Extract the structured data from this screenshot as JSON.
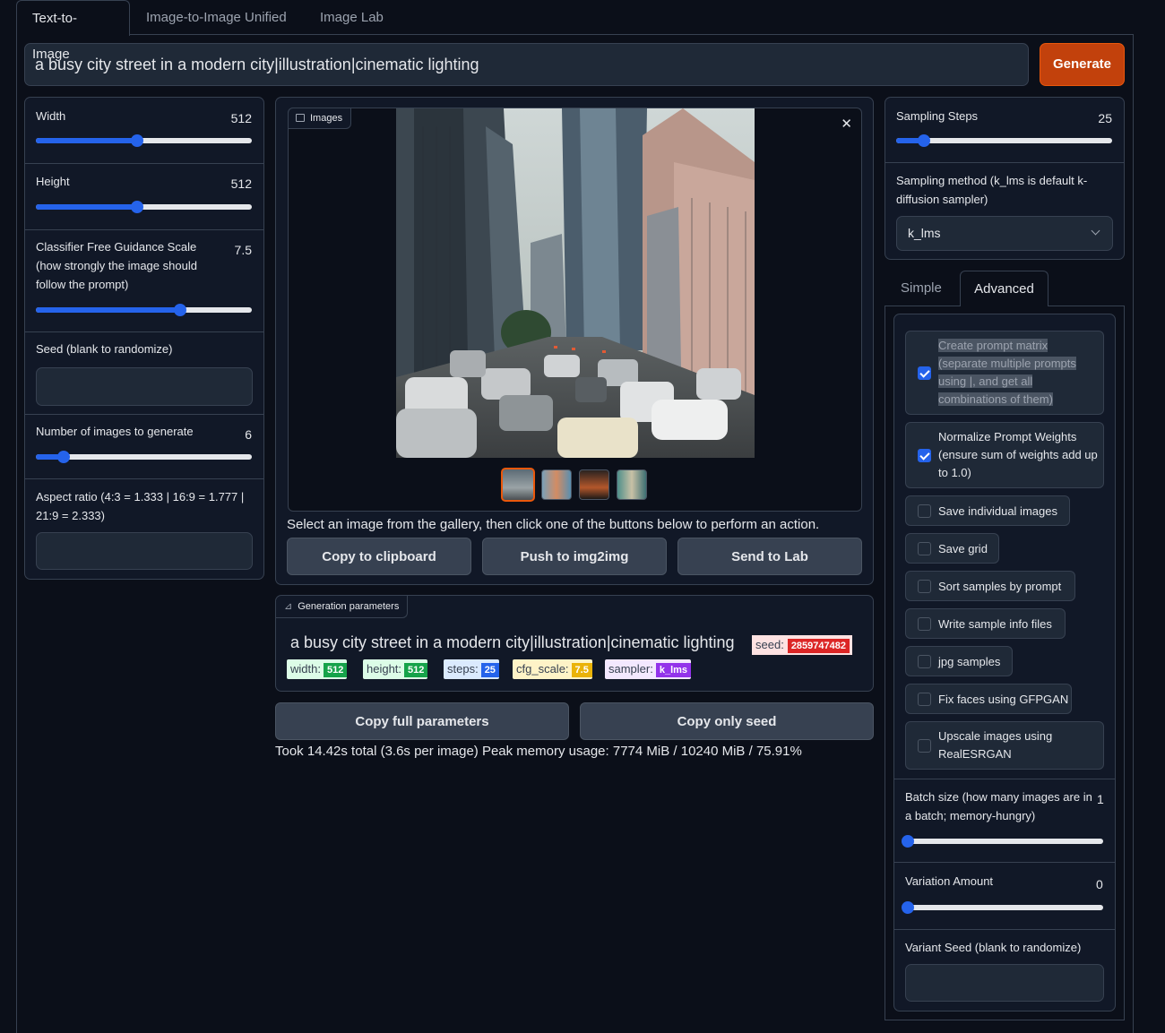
{
  "tabs": [
    "Text-to-Image",
    "Image-to-Image Unified",
    "Image Lab"
  ],
  "prompt": "a busy city street in a modern city|illustration|cinematic lighting",
  "generate_label": "Generate",
  "left": {
    "width": {
      "label": "Width",
      "value": "512",
      "level": 0.47
    },
    "height": {
      "label": "Height",
      "value": "512",
      "level": 0.47
    },
    "cfg": {
      "label": "Classifier Free Guidance Scale (how strongly the image should follow the prompt)",
      "value": "7.5",
      "level": 0.67
    },
    "seed": {
      "label": "Seed (blank to randomize)",
      "value": ""
    },
    "num_images": {
      "label": "Number of images to generate",
      "value": "6",
      "level": 0.13
    },
    "aspect": {
      "label": "Aspect ratio (4:3 = 1.333 | 16:9 = 1.777 | 21:9 = 2.333)",
      "value": ""
    }
  },
  "gallery": {
    "label": "Images",
    "hint": "Select an image from the gallery, then click one of the buttons below to perform an action.",
    "buttons": [
      "Copy to clipboard",
      "Push to img2img",
      "Send to Lab"
    ],
    "thumbnail_count": 4,
    "selected_thumbnail": 1
  },
  "params": {
    "label": "Generation parameters",
    "prompt": "a busy city street in a modern city|illustration|cinematic lighting",
    "seed_key": "seed:",
    "seed_value": "2859747482",
    "chips": [
      {
        "key": "width:",
        "value": "512"
      },
      {
        "key": "height:",
        "value": "512"
      },
      {
        "key": "steps:",
        "value": "25"
      },
      {
        "key": "cfg_scale:",
        "value": "7.5"
      },
      {
        "key": "sampler:",
        "value": "k_lms"
      }
    ]
  },
  "copy_full_label": "Copy full parameters",
  "copy_seed_label": "Copy only seed",
  "stats": "Took 14.42s total (3.6s per image) Peak memory usage: 7774 MiB / 10240 MiB / 75.91%",
  "right": {
    "steps": {
      "label": "Sampling Steps",
      "value": "25",
      "level": 0.13
    },
    "sampler": {
      "label": "Sampling method (k_lms is default k-diffusion sampler)",
      "value": "k_lms"
    },
    "subtabs": [
      "Simple",
      "Advanced"
    ],
    "options": [
      {
        "label": "Create prompt matrix (separate multiple prompts using |, and get all combinations of them)",
        "checked": true
      },
      {
        "label": "Normalize Prompt Weights (ensure sum of weights add up to 1.0)",
        "checked": true
      },
      {
        "label": "Save individual images",
        "checked": false
      },
      {
        "label": "Save grid",
        "checked": false
      },
      {
        "label": "Sort samples by prompt",
        "checked": false
      },
      {
        "label": "Write sample info files",
        "checked": false
      },
      {
        "label": "jpg samples",
        "checked": false
      },
      {
        "label": "Fix faces using GFPGAN",
        "checked": false
      },
      {
        "label": "Upscale images using RealESRGAN",
        "checked": false
      }
    ],
    "batch": {
      "label": "Batch size (how many images are in a batch; memory-hungry)",
      "value": "1",
      "level": 0
    },
    "variation": {
      "label": "Variation Amount",
      "value": "0",
      "level": 0
    },
    "variant_seed": {
      "label": "Variant Seed (blank to randomize)",
      "value": ""
    }
  },
  "colors": {
    "accent": "#2563eb",
    "generate": "#c2410c",
    "background": "#0b0f19",
    "panel": "#111827"
  }
}
